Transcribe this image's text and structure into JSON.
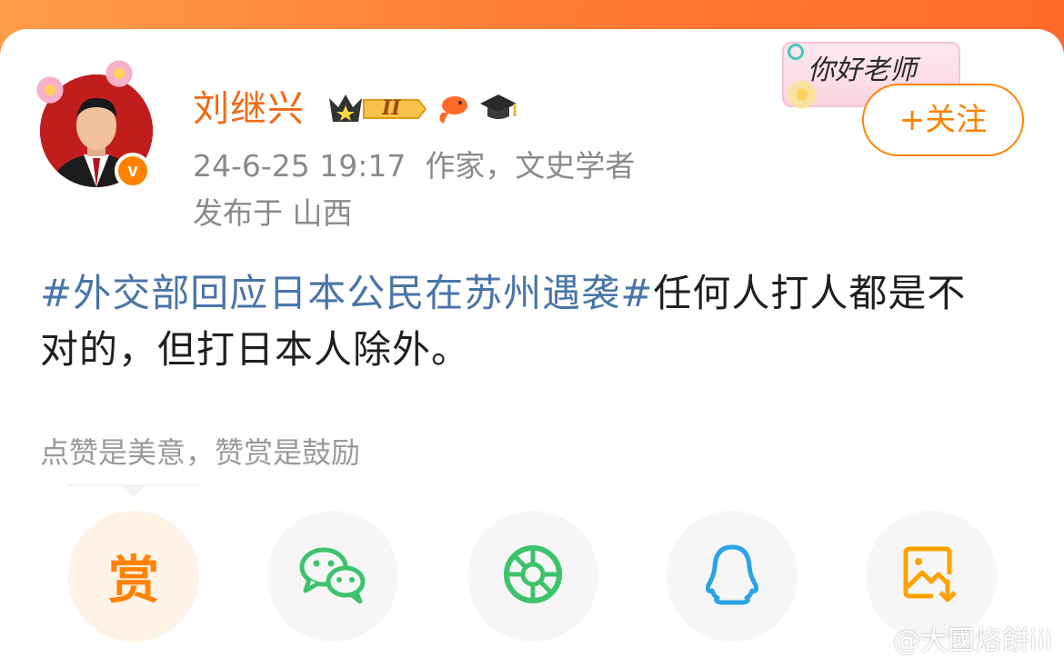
{
  "author": {
    "name": "刘继兴",
    "level_badge": "II",
    "verified_mark": "v",
    "avatar_alt": "avatar"
  },
  "post_meta": {
    "line1": "24-6-25 19:17  作家，文史学者",
    "line2": "发布于 山西"
  },
  "follow_button": {
    "label": "+关注"
  },
  "greeting_card": {
    "text": "你好老师"
  },
  "post": {
    "hashtag": "#外交部回应日本公民在苏州遇袭#",
    "text": "任何人打人都是不对的，但打日本人除外。"
  },
  "reward_hint": "点赞是美意，赞赏是鼓励",
  "share_actions": [
    {
      "name": "reward",
      "label": "赏",
      "icon": "reward-icon"
    },
    {
      "name": "wechat",
      "icon": "wechat-icon"
    },
    {
      "name": "moments",
      "icon": "moments-icon"
    },
    {
      "name": "qq",
      "icon": "qq-icon"
    },
    {
      "name": "save-image",
      "icon": "save-image-icon"
    }
  ],
  "watermark": "@大國烙餅iii",
  "colors": {
    "brand_orange": "#ff8200",
    "name_orange": "#f06a14",
    "hashtag_blue": "#4a75a8",
    "wechat_green": "#3cc36b",
    "qq_blue": "#2aa4e4",
    "save_orange": "#ffa200"
  }
}
